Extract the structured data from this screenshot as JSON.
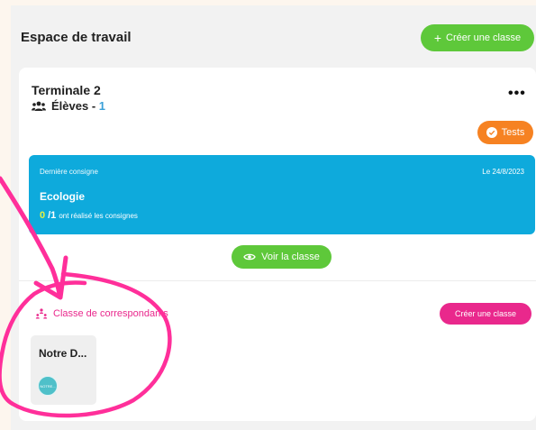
{
  "workspace": {
    "title": "Espace de travail",
    "create_button": "Créer une classe"
  },
  "class_card": {
    "name": "Terminale 2",
    "students_label": "Élèves - ",
    "students_count": "1",
    "more_icon": "ellipsis-icon",
    "tests_button": "Tests",
    "assignment": {
      "label": "Dernière consigne",
      "date": "Le 24/8/2023",
      "title": "Ecologie",
      "done": "0",
      "total": "/1",
      "progress_text": "ont réalisé les consignes"
    },
    "view_button": "Voir la classe"
  },
  "correspondents": {
    "title": "Classe de correspondants",
    "create_button": "Créer une classe",
    "classes": [
      {
        "name": "Notre D...",
        "avatar_text": "NOTRE..."
      }
    ]
  },
  "colors": {
    "green": "#5ec83a",
    "orange": "#f68222",
    "blue": "#0eaadc",
    "pink": "#e9288c",
    "annotation": "#ff2f9a"
  }
}
